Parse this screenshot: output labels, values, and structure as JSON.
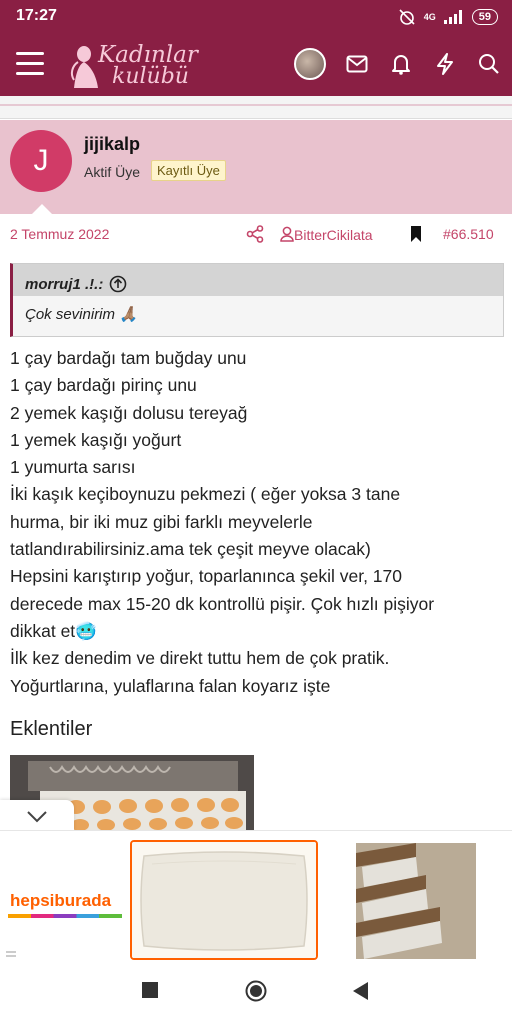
{
  "status_bar": {
    "time": "17:27",
    "network": "4G",
    "battery": "59"
  },
  "app_bar": {
    "logo_line1": "Kadınlar",
    "logo_line2": "kulübü"
  },
  "post": {
    "username": "jijikalp",
    "avatar_letter": "J",
    "user_title": "Aktif Üye",
    "badge": "Kayıtlı Üye",
    "date": "2 Temmuz 2022",
    "author_link": "BitterCikilata",
    "post_number": "#66.510",
    "quote": {
      "author": "morruj1 .!.:",
      "text": "Çok sevinirim 🙏🏽"
    },
    "lines": [
      "1 çay bardağı tam buğday unu",
      "1 çay bardağı pirinç unu",
      "2 yemek kaşığı dolusu tereyağ",
      "1 yemek kaşığı yoğurt",
      "1 yumurta sarısı",
      "İki kaşık keçiboynuzu pekmezi ( eğer yoksa 3 tane",
      "hurma, bir iki muz gibi farklı meyvelerle",
      "tatlandırabilirsiniz.ama tek çeşit meyve olacak)",
      "Hepsini karıştırıp yoğur, toparlanınca şekil ver, 170",
      "derecede max 15-20 dk kontrollü pişir. Çok hızlı pişiyor",
      "dikkat et🥶",
      "İlk kez denedim ve direkt tuttu hem de çok pratik.",
      "Yoğurtlarına, yulaflarına falan koyarız işte"
    ],
    "attachments_title": "Eklentiler"
  },
  "ad": {
    "brand": "hepsiburada"
  },
  "colors": {
    "brand": "#8a1f44",
    "user_box": "#e9c2ce",
    "accent": "#c44569",
    "ad_highlight": "#ff6000"
  },
  "icons": [
    "menu-icon",
    "mail-icon",
    "bell-icon",
    "bolt-icon",
    "search-icon",
    "share-icon",
    "user-icon",
    "bookmark-icon",
    "arrow-up-circle-icon",
    "chevron-down-icon",
    "stop-icon",
    "home-circle-icon",
    "back-triangle-icon"
  ]
}
